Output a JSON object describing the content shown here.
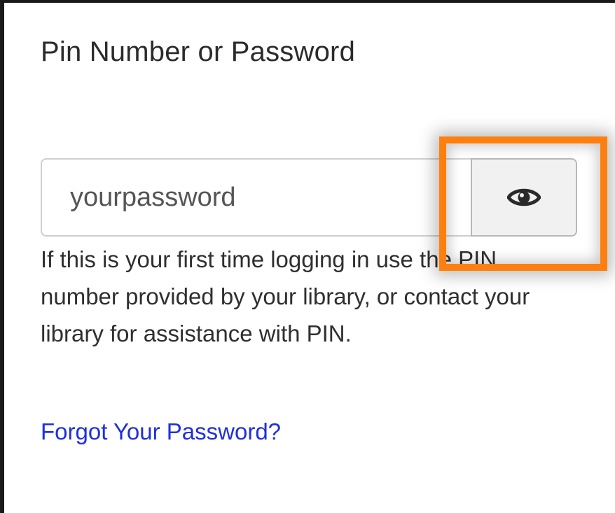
{
  "field": {
    "label": "Pin Number or Password",
    "value": "yourpassword"
  },
  "toggle_button": {
    "icon": "eye-icon",
    "highlight_color": "#ff7f0e"
  },
  "help_text": "If this is your first time logging in use the PIN number provided by your library, or contact your library for assistance with PIN.",
  "forgot_link": {
    "label": "Forgot Your Password?",
    "color": "#1f2fe0"
  }
}
